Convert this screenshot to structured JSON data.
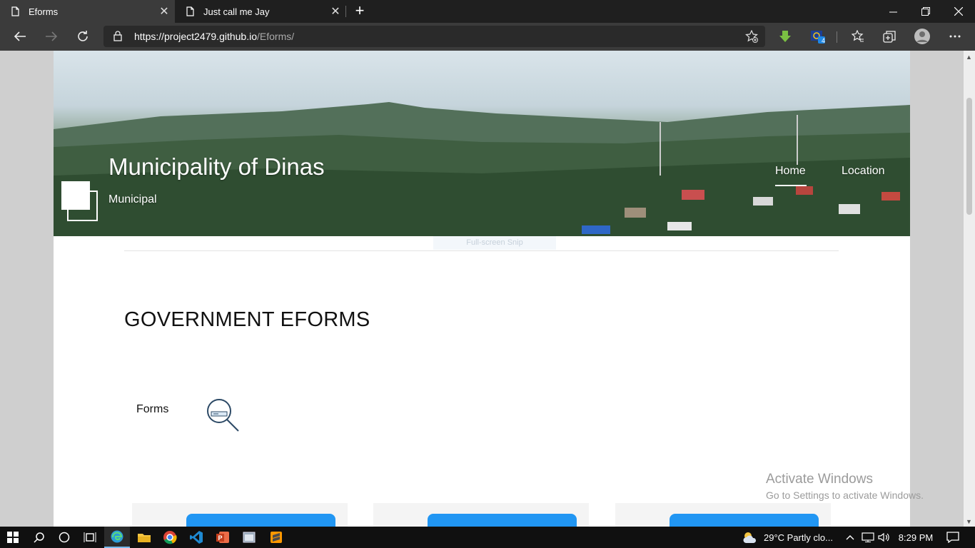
{
  "browser": {
    "tabs": [
      {
        "title": "Eforms",
        "active": true
      },
      {
        "title": "Just call me Jay",
        "active": false
      }
    ],
    "address": {
      "host": "https://project2479.github.io",
      "path": "/Eforms/"
    },
    "extension_badge": "4"
  },
  "site": {
    "title": "Municipality of Dinas",
    "subtitle": "Municipal",
    "nav": {
      "home": "Home",
      "location": "Location"
    }
  },
  "overlay": {
    "snip_hint": "Full-screen Snip"
  },
  "main": {
    "heading": "GOVERNMENT EFORMS",
    "forms_label": "Forms"
  },
  "watermark": {
    "title": "Activate Windows",
    "subtitle": "Go to Settings to activate Windows."
  },
  "taskbar": {
    "weather": "29°C  Partly clo...",
    "time": "8:29 PM"
  },
  "colors": {
    "accent_button": "#2196f3",
    "browser_dark": "#3b3b3b",
    "tabbar": "#1f1f1f"
  }
}
